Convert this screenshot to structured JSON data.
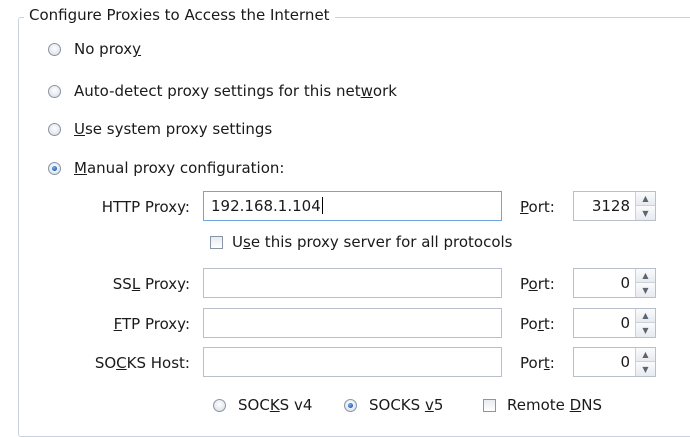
{
  "group_title": "Configure Proxies to Access the Internet",
  "options": {
    "no_proxy": {
      "pre": "No prox",
      "u": "y",
      "post": ""
    },
    "auto_detect": {
      "pre": "Auto-detect proxy settings for this net",
      "u": "w",
      "post": "ork"
    },
    "system": {
      "pre": "",
      "u": "U",
      "post": "se system proxy settings"
    },
    "manual": {
      "pre": "",
      "u": "M",
      "post": "anual proxy configuration:"
    },
    "selected": "manual"
  },
  "http": {
    "label": "HTTP Proxy:",
    "value": "192.168.1.104",
    "port_label": {
      "pre": "",
      "u": "P",
      "post": "ort:"
    },
    "port": "3128"
  },
  "use_for_all": {
    "pre": "U",
    "u": "s",
    "post": "e this proxy server for all protocols",
    "checked": false
  },
  "ssl": {
    "label": {
      "pre": "SS",
      "u": "L",
      "post": " Proxy:"
    },
    "value": "",
    "port_label": {
      "pre": "P",
      "u": "o",
      "post": "rt:"
    },
    "port": "0"
  },
  "ftp": {
    "label": {
      "pre": "",
      "u": "F",
      "post": "TP Proxy:"
    },
    "value": "",
    "port_label": {
      "pre": "Po",
      "u": "r",
      "post": "t:"
    },
    "port": "0"
  },
  "socks": {
    "label": {
      "pre": "SO",
      "u": "C",
      "post": "KS Host:"
    },
    "value": "",
    "port_label": {
      "pre": "Por",
      "u": "t",
      "post": ":"
    },
    "port": "0"
  },
  "socks_version": {
    "v4": {
      "pre": "SOC",
      "u": "K",
      "post": "S v4"
    },
    "v5": {
      "pre": "SOCKS ",
      "u": "v",
      "post": "5"
    },
    "selected": "v5"
  },
  "remote_dns": {
    "pre": "Remote ",
    "u": "D",
    "post": "NS",
    "checked": false
  },
  "icons": {
    "spin_up": "▲",
    "spin_down": "▼"
  }
}
